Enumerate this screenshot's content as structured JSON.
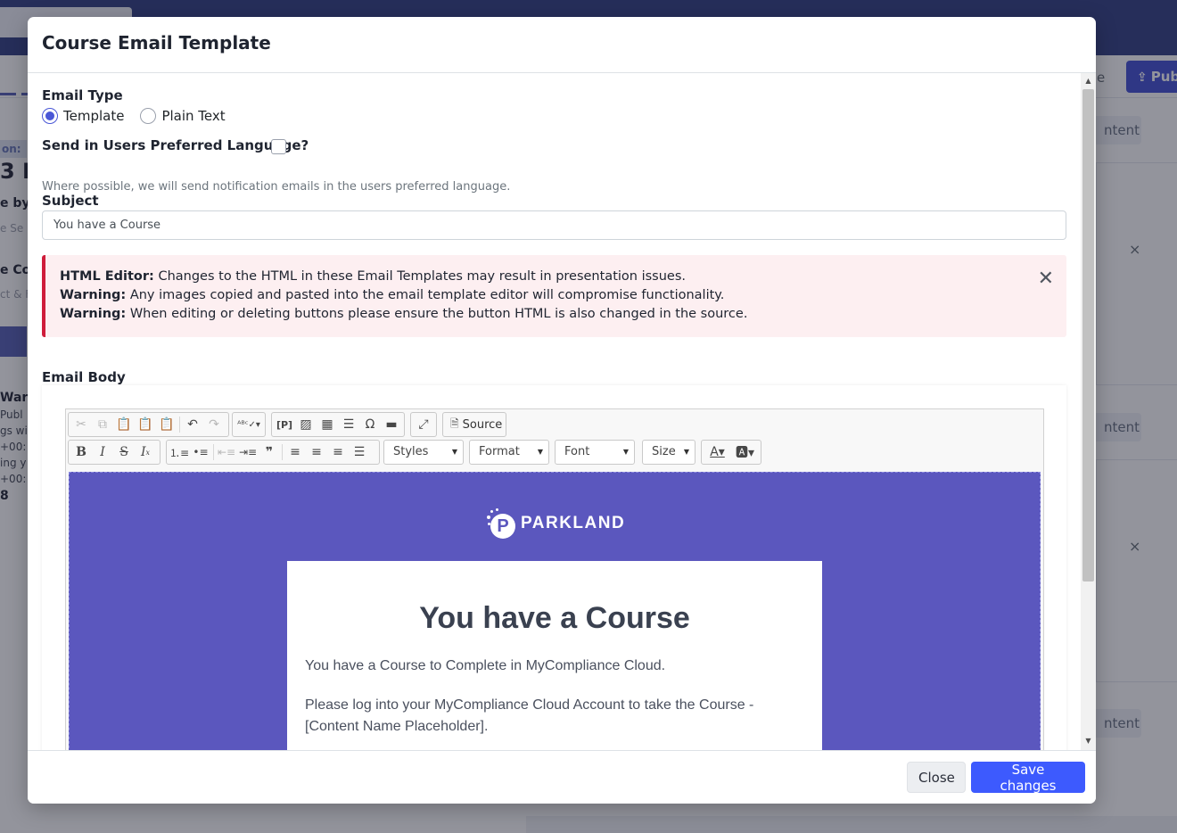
{
  "background": {
    "publish_label": "Pub",
    "tab_right_label": "e",
    "edition_label": "on: 1",
    "heading_fragment": "3 I",
    "left_texts": [
      "e by",
      "e Se",
      "e Co",
      "ct & F",
      "War",
      "Publ",
      "gs wi",
      "+00:",
      "ing y",
      "+00:",
      "8"
    ],
    "content_label": "ntent",
    "close_glyph": "×"
  },
  "modal": {
    "title": "Course Email Template",
    "email_type": {
      "label": "Email Type",
      "options": [
        {
          "label": "Template",
          "checked": true
        },
        {
          "label": "Plain Text",
          "checked": false
        }
      ]
    },
    "preferred_language": {
      "label": "Send in Users Preferred Language?",
      "checked": false,
      "help": "Where possible, we will send notification emails in the users preferred language."
    },
    "subject": {
      "label": "Subject",
      "value": "You have a Course"
    },
    "alert": {
      "lines": [
        {
          "strong": "HTML Editor:",
          "text": " Changes to the HTML in these Email Templates may result in presentation issues."
        },
        {
          "strong": "Warning:",
          "text": " Any images copied and pasted into the email template editor will compromise functionality."
        },
        {
          "strong": "Warning:",
          "text": " When editing or deleting buttons please ensure the button HTML is also changed in the source."
        }
      ],
      "close_glyph": "✕"
    },
    "email_body": {
      "label": "Email Body",
      "toolbar": {
        "source_label": "Source",
        "styles_label": "Styles",
        "format_label": "Format",
        "font_label": "Font",
        "size_label": "Size"
      },
      "preview": {
        "brand": "PARKLAND",
        "heading": "You have a Course",
        "paragraph1": "You have a Course to Complete in MyCompliance Cloud.",
        "paragraph2": "Please log into your MyCompliance Cloud Account to take the Course - [Content Name Placeholder].",
        "accent_color": "#5b57be"
      }
    },
    "footer": {
      "close_label": "Close",
      "save_label": "Save changes"
    }
  }
}
